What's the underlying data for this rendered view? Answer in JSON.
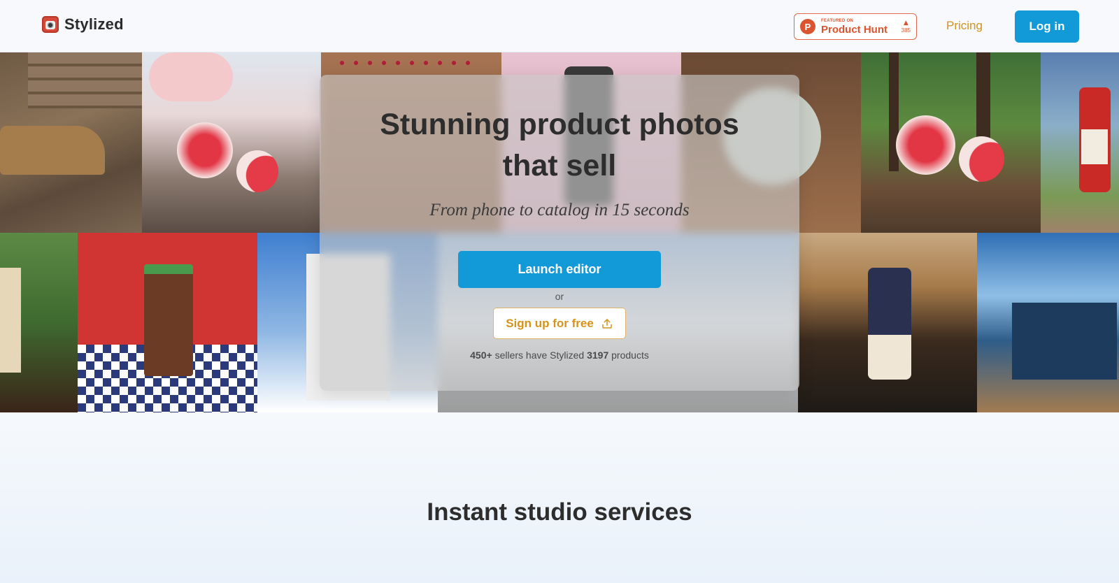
{
  "brand": {
    "name": "Stylized"
  },
  "product_hunt": {
    "featured_label": "FEATURED ON",
    "name": "Product Hunt",
    "votes": "385",
    "logo_letter": "P",
    "color": "#da552f"
  },
  "nav": {
    "pricing": "Pricing",
    "login": "Log in"
  },
  "hero": {
    "title_line1": "Stunning product photos",
    "title_line2": "that sell",
    "subtitle": "From phone to catalog in 15 seconds",
    "launch_button": "Launch editor",
    "or": "or",
    "signup_button": "Sign up for free",
    "sellers_count": "450+",
    "sellers_text": " sellers have Stylized ",
    "products_count": "3197",
    "products_text": " products"
  },
  "section": {
    "title": "Instant studio services"
  },
  "colors": {
    "primary": "#129ad8",
    "accent": "#d4931c",
    "background": "#f4f8fc"
  },
  "gallery": [
    {
      "name": "boot-photo",
      "bg": "linear-gradient(160deg,#6f5a45 0%,#8a7258 40%,#5c4a3a 70%,#7a6652 100%)"
    },
    {
      "name": "soap-roses-photo",
      "bg": "linear-gradient(180deg,#dfe6ee 0%,#e8d7d8 35%,#8a7a70 70%,#5a4c44 100%)"
    },
    {
      "name": "petals-photo",
      "bg": "linear-gradient(180deg,#a67452 0%,#8c5a3e 100%)"
    },
    {
      "name": "blossom-photo",
      "bg": "linear-gradient(180deg,#e8c2d0 0%,#d8a8bb 100%)"
    },
    {
      "name": "bowl-photo",
      "bg": "linear-gradient(180deg,#6b4a34 0%,#9c6f4c 100%)"
    },
    {
      "name": "forest-soap-photo",
      "bg": "linear-gradient(180deg,#3f6f36 0%,#5c8a3f 40%,#6b4e38 75%,#4e3a2a 100%)"
    },
    {
      "name": "juice-photo",
      "bg": "linear-gradient(180deg,#5b7fb0 0%,#8aaec8 40%,#7a9a55 80%,#a0826a 100%)"
    },
    {
      "name": "coffee-plant-photo",
      "bg": "linear-gradient(180deg,#5d8a45 0%,#3f6a30 50%,#3a2418 100%)"
    },
    {
      "name": "mylk-bar-photo",
      "bg": "linear-gradient(180deg,#d93a36 0%,#c42d2b 60%,#2a3a7a 60%,#ffffff 100%)"
    },
    {
      "name": "sky-box-photo",
      "bg": "linear-gradient(180deg,#3f7fd0 0%,#8fb7e3 55%,#ffffff 100%)"
    },
    {
      "name": "espresso-can-photo",
      "bg": "linear-gradient(180deg,#c8a880 0%,#a67a4a 30%,#3a2a1e 60%,#1e1a16 100%)"
    },
    {
      "name": "snow-crab-photo",
      "bg": "linear-gradient(180deg,#2f6fb5 0%,#8fbfe6 35%,#2e5d8a 60%,#a27b50 100%)"
    }
  ]
}
